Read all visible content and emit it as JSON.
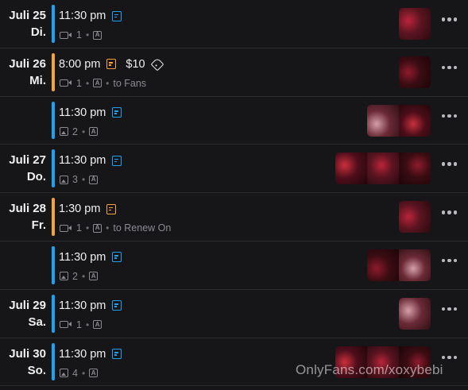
{
  "colors": {
    "scheduled": "#1da1f2",
    "pending": "#f6a23a",
    "background": "#161618",
    "meta": "#8a8a93"
  },
  "rows": [
    {
      "day": "Juli 25",
      "weekday": "Di.",
      "time": "11:30 pm",
      "status": "scheduled",
      "price": "",
      "media_type": "video-icon",
      "count": "1",
      "extra": "",
      "thumb_count": 1
    },
    {
      "day": "Juli 26",
      "weekday": "Mi.",
      "time": "8:00 pm",
      "status": "pending",
      "price": "$10",
      "media_type": "video-icon",
      "count": "1",
      "extra": "to Fans",
      "thumb_count": 1
    },
    {
      "day": "",
      "weekday": "",
      "time": "11:30 pm",
      "status": "scheduled",
      "price": "",
      "media_type": "image-icon",
      "count": "2",
      "extra": "",
      "thumb_count": 2
    },
    {
      "day": "Juli 27",
      "weekday": "Do.",
      "time": "11:30 pm",
      "status": "scheduled",
      "price": "",
      "media_type": "image-icon",
      "count": "3",
      "extra": "",
      "thumb_count": 3
    },
    {
      "day": "Juli 28",
      "weekday": "Fr.",
      "time": "1:30 pm",
      "status": "pending",
      "price": "",
      "media_type": "video-icon",
      "count": "1",
      "extra": "to Renew On",
      "thumb_count": 1
    },
    {
      "day": "",
      "weekday": "",
      "time": "11:30 pm",
      "status": "scheduled",
      "price": "",
      "media_type": "image-icon",
      "count": "2",
      "extra": "",
      "thumb_count": 2
    },
    {
      "day": "Juli 29",
      "weekday": "Sa.",
      "time": "11:30 pm",
      "status": "scheduled",
      "price": "",
      "media_type": "video-icon",
      "count": "1",
      "extra": "",
      "thumb_count": 1
    },
    {
      "day": "Juli 30",
      "weekday": "So.",
      "time": "11:30 pm",
      "status": "scheduled",
      "price": "",
      "media_type": "image-icon",
      "count": "4",
      "extra": "",
      "thumb_count": 3
    }
  ],
  "access_badge": "A",
  "separator": "•",
  "watermark": "OnlyFans.com/xoxybebi"
}
